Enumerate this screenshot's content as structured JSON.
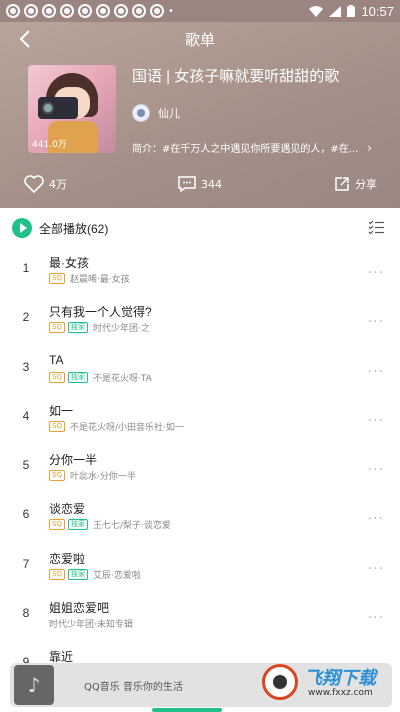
{
  "status_bar": {
    "time": "10:57"
  },
  "nav": {
    "title": "歌单"
  },
  "playlist": {
    "title": "国语 | 女孩子嘛就要听甜甜的歌",
    "creator": "仙儿",
    "intro": "简介：#在千万人之中遇见你所要遇见的人，#在...",
    "cover_play_count": "441.0万"
  },
  "actions": {
    "like_count": "4万",
    "comment_count": "344",
    "share_label": "分享"
  },
  "list_header": {
    "play_all": "全部播放(62)"
  },
  "songs": [
    {
      "num": "1",
      "title": "最·女孩",
      "sq": "SQ",
      "exclusive": "",
      "artist": "赵晨唏·最·女孩"
    },
    {
      "num": "2",
      "title": "只有我一个人觉得?",
      "sq": "SQ",
      "exclusive": "独家",
      "artist": "时代少年团·之"
    },
    {
      "num": "3",
      "title": "TA",
      "sq": "SQ",
      "exclusive": "独家",
      "artist": "不是花火呀·TA"
    },
    {
      "num": "4",
      "title": "如一",
      "sq": "SQ",
      "exclusive": "",
      "artist": "不是花火呀/小田音乐社·如一"
    },
    {
      "num": "5",
      "title": "分你一半",
      "sq": "SQ",
      "exclusive": "",
      "artist": "叶惢水·分你一半"
    },
    {
      "num": "6",
      "title": "谈恋爱",
      "sq": "SQ",
      "exclusive": "独家",
      "artist": "王七七/梨子·谈恋爱"
    },
    {
      "num": "7",
      "title": "恋爱啦",
      "sq": "SQ",
      "exclusive": "独家",
      "artist": "艾辰·恋爱啦"
    },
    {
      "num": "8",
      "title": "姐姐恋爱吧",
      "sq": "",
      "exclusive": "",
      "artist": "时代少年团·未知专辑"
    },
    {
      "num": "9",
      "title": "靠近",
      "sq": "",
      "exclusive": "",
      "artist": ""
    }
  ],
  "mini_player": {
    "text": "QQ音乐 音乐你的生活"
  },
  "watermark": {
    "title": "飞翔下载",
    "url": "www.fxxz.com"
  },
  "colors": {
    "accent": "#22c08a",
    "sq_badge": "#f0a030",
    "hero_bg": "#a38f87"
  },
  "icons": {
    "back": "back-arrow-icon",
    "like": "heart-icon",
    "comment": "comment-icon",
    "share": "share-icon",
    "play_all": "play-circle-icon",
    "multi_select": "multi-select-icon",
    "more": "more-dots-icon"
  }
}
